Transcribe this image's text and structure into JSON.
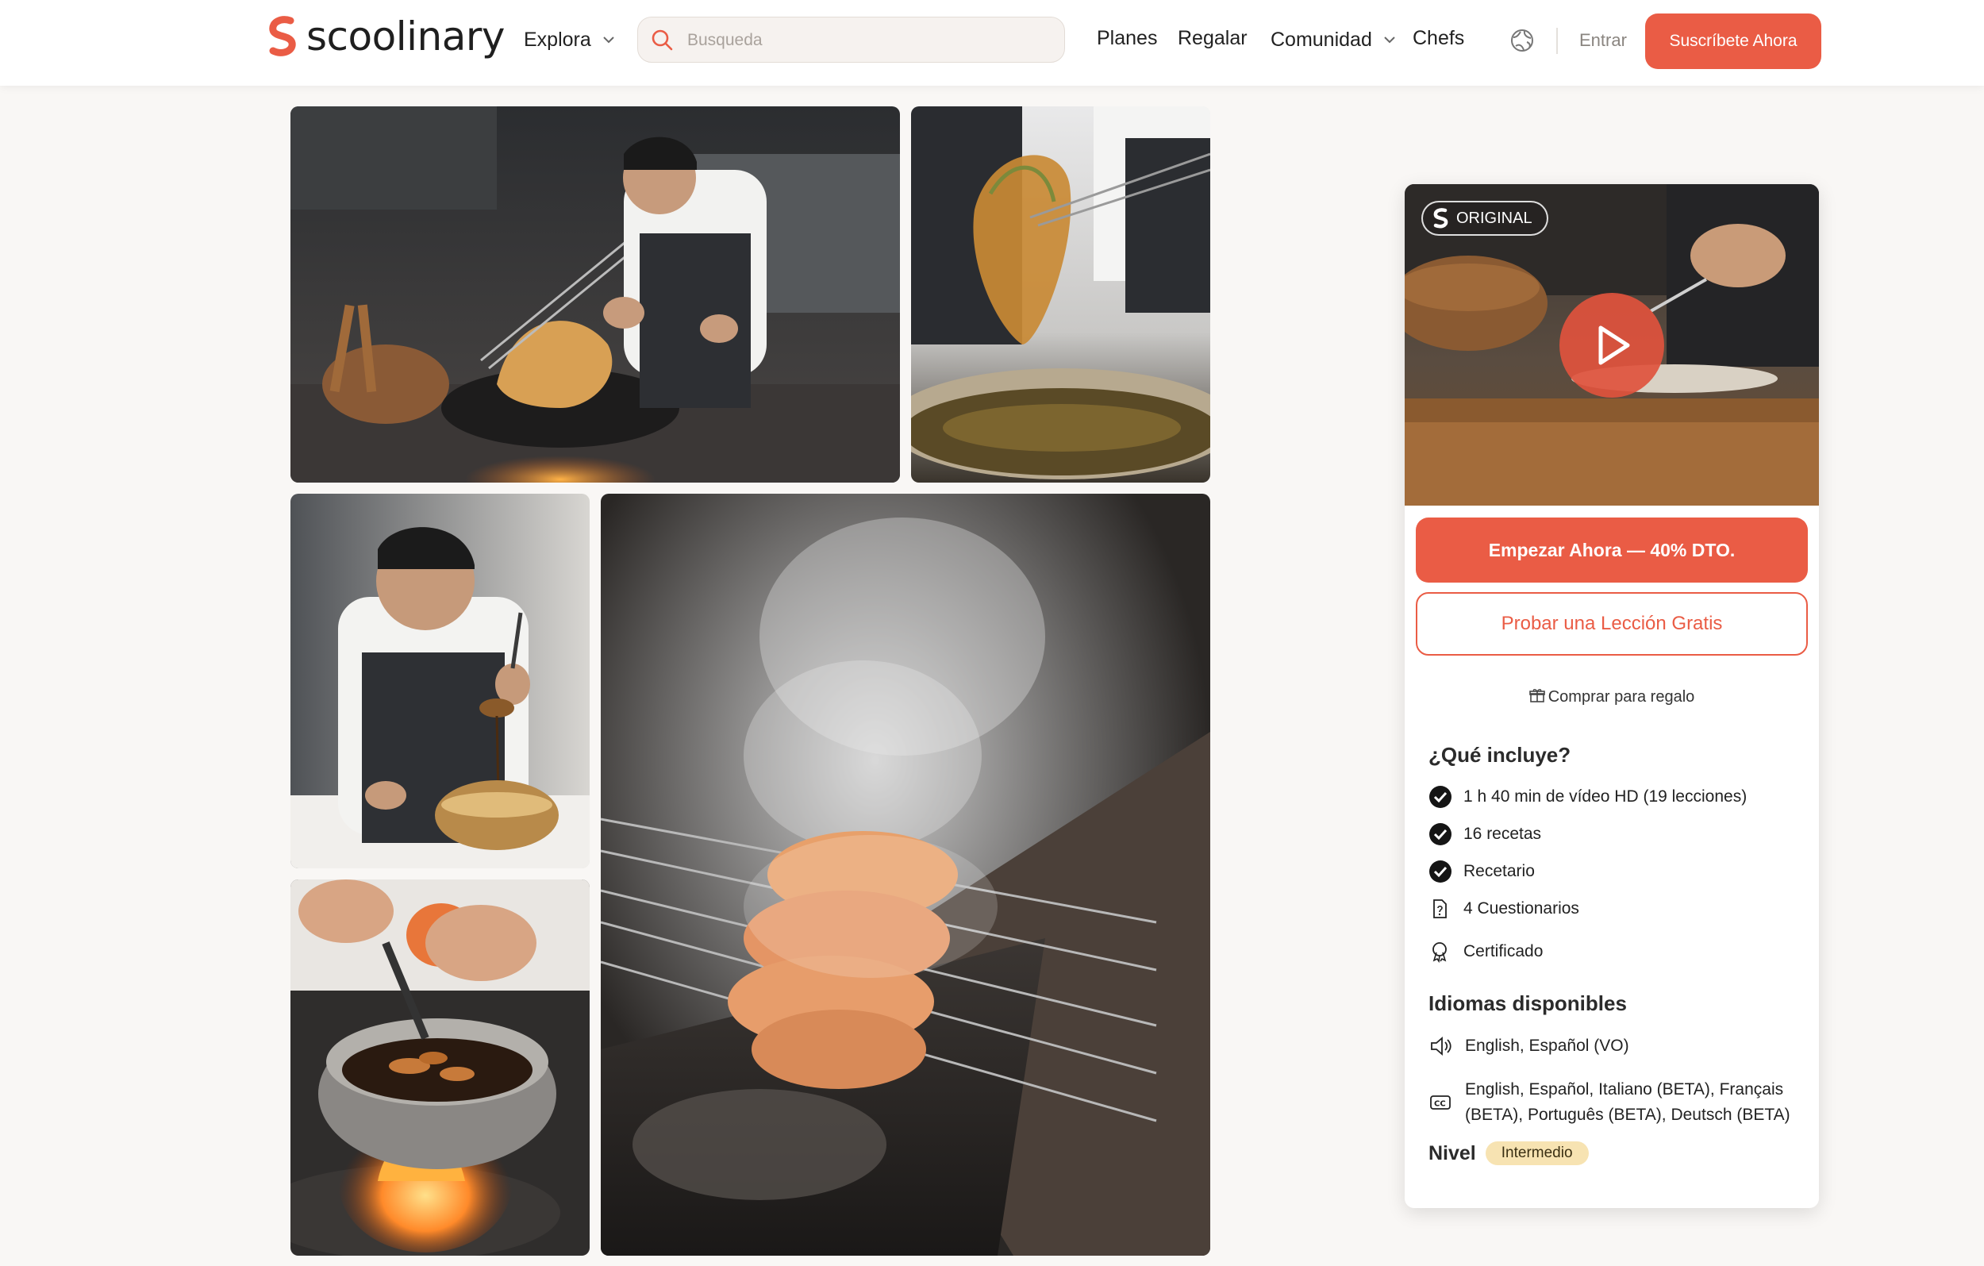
{
  "brand": {
    "name": "scoolinary",
    "accent": "#ea5c45"
  },
  "nav": {
    "explore": "Explora",
    "search_placeholder": "Busqueda",
    "links": [
      "Planes",
      "Regalar"
    ],
    "community": "Comunidad",
    "chefs": "Chefs",
    "login": "Entrar",
    "subscribe": "Suscríbete Ahora"
  },
  "course_card": {
    "badge": "ORIGINAL",
    "cta": "Empezar Ahora — 40% DTO.",
    "trial": "Probar una Lección Gratis",
    "gift": "Comprar para regalo",
    "includes_title": "¿Qué incluye?",
    "includes": [
      "1 h 40 min de vídeo HD (19 lecciones)",
      "16 recetas",
      "Recetario",
      "4 Cuestionarios",
      "Certificado"
    ],
    "languages_title": "Idiomas disponibles",
    "audio_languages": "English, Español (VO)",
    "subtitle_languages_line1": "English, Español, Italiano (BETA), Français",
    "subtitle_languages_line2": "(BETA), Português (BETA), Deutsch (BETA)",
    "level_label": "Nivel",
    "level_value": "Intermedio"
  }
}
